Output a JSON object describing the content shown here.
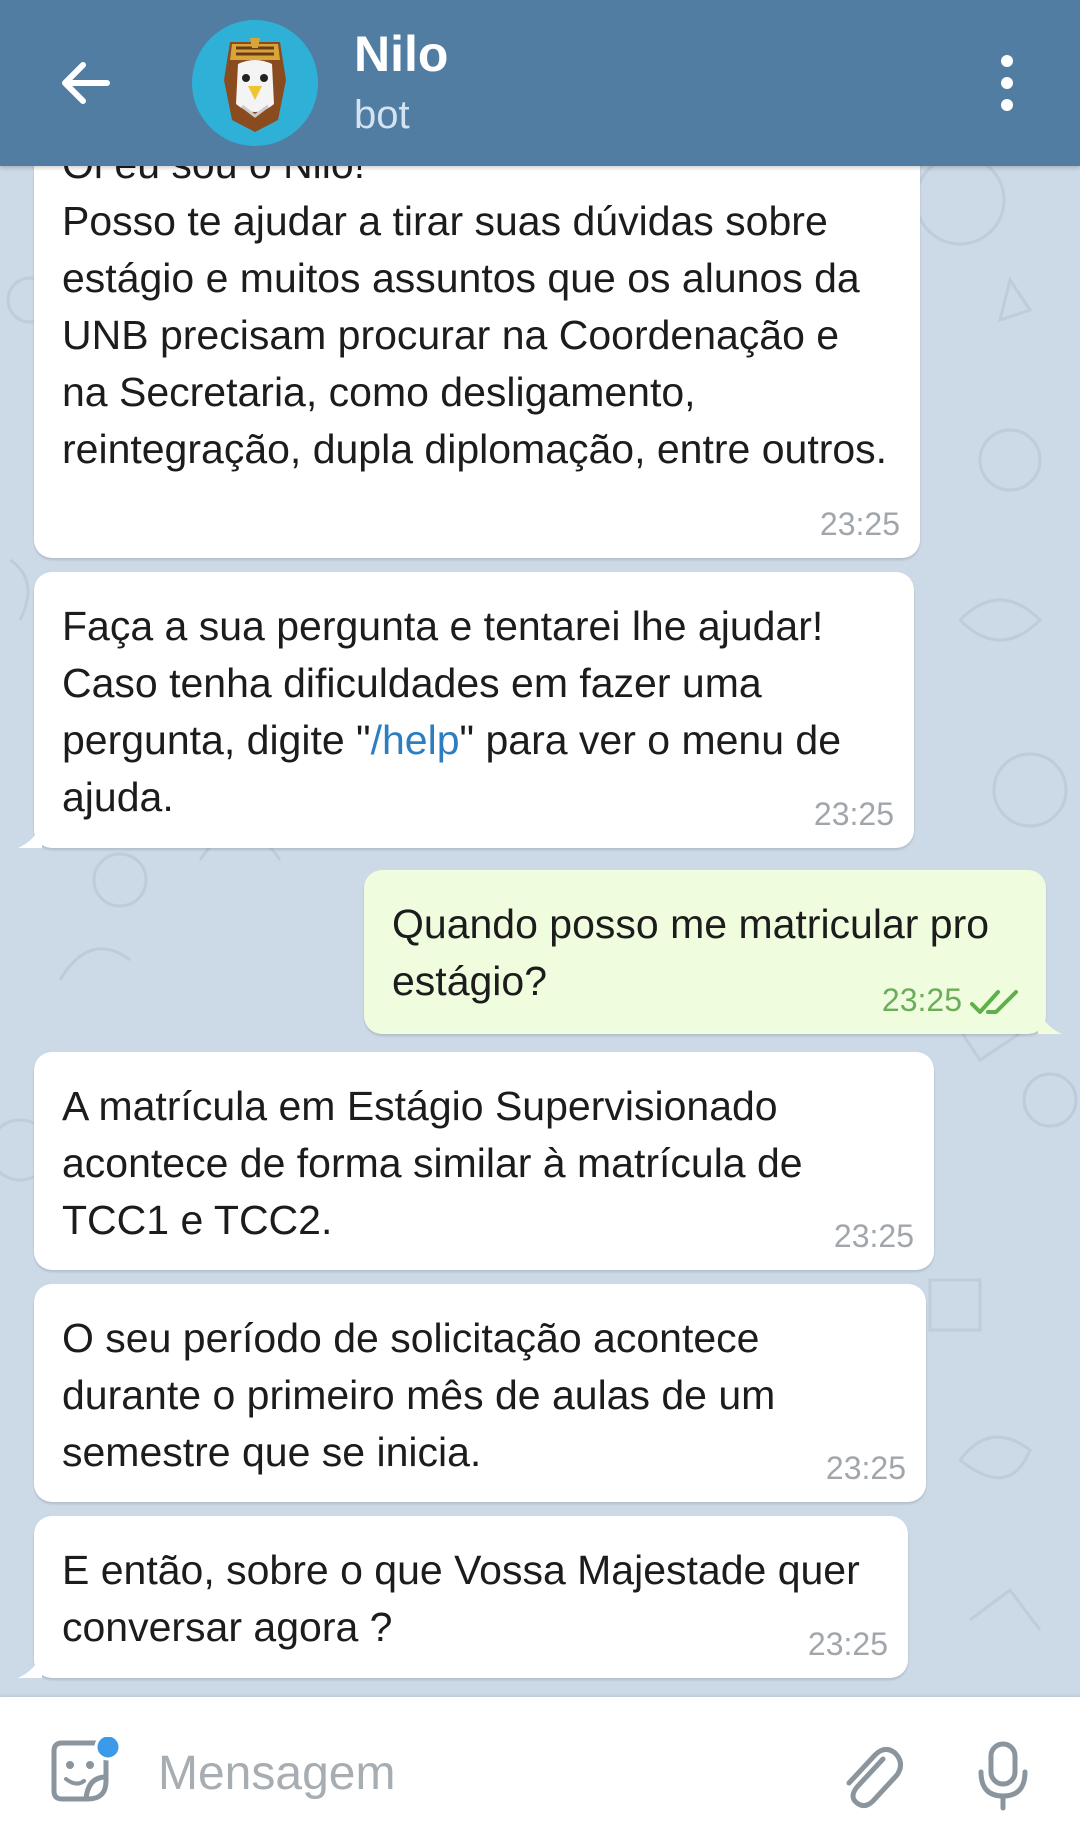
{
  "header": {
    "title": "Nilo",
    "subtitle": "bot"
  },
  "messages": [
    {
      "direction": "in",
      "text": "Oi eu sou o Nilo!\nPosso te ajudar a tirar suas dúvidas sobre estágio e muitos assuntos que os alunos da UNB precisam procurar na Coordenação e na Secretaria, como desligamento, reintegração, dupla diplomação, entre outros.",
      "time": "23:25"
    },
    {
      "direction": "in",
      "text_before": "Faça a sua pergunta e tentarei lhe ajudar! Caso tenha dificuldades em fazer uma pergunta, digite \"",
      "link": "/help",
      "text_after": "\" para ver o menu de ajuda.",
      "time": "23:25"
    },
    {
      "direction": "out",
      "text": "Quando posso me matricular pro estágio?",
      "time": "23:25",
      "status": "read"
    },
    {
      "direction": "in",
      "text": "A matrícula em Estágio Supervisionado acontece de forma similar à matrícula de TCC1 e TCC2.",
      "time": "23:25"
    },
    {
      "direction": "in",
      "text": "O seu período de solicitação acontece durante o primeiro mês de aulas de um semestre que se inicia.",
      "time": "23:25"
    },
    {
      "direction": "in",
      "text": "E então, sobre o que Vossa Majestade quer conversar agora ?",
      "time": "23:25"
    }
  ],
  "input": {
    "placeholder": "Mensagem",
    "value": ""
  },
  "colors": {
    "header": "#517da2",
    "chat_background": "#ccd9e6",
    "incoming_bubble": "#ffffff",
    "outgoing_bubble": "#effdde",
    "link": "#2c7ec1",
    "outgoing_time": "#6cad5a",
    "sticker_badge": "#3d9ae8"
  },
  "icons": {
    "back": "arrow-left-icon",
    "menu": "more-vertical-icon",
    "sticker": "sticker-icon",
    "attach": "paperclip-icon",
    "mic": "microphone-icon",
    "read_status": "double-check-icon"
  }
}
